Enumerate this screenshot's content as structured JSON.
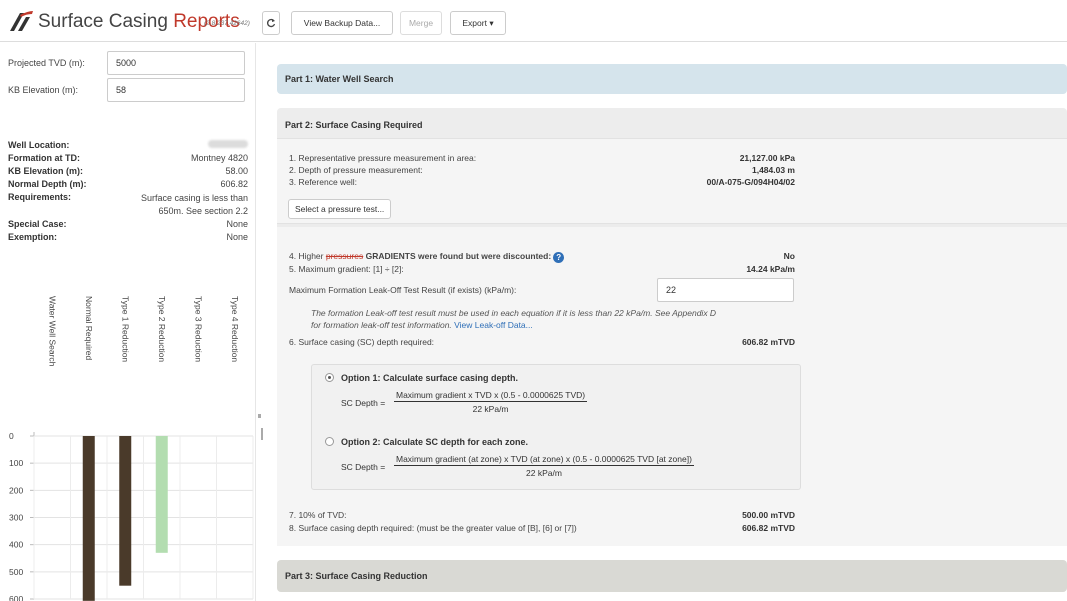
{
  "header": {
    "title_part1": "Surface Casing",
    "title_part2": "Reports",
    "version": "(2.8.237.42642)",
    "buttons": {
      "refresh_icon": "refresh-icon",
      "view_backup": "View Backup Data...",
      "merge": "Merge",
      "export": "Export ▾"
    }
  },
  "inputs": {
    "projected_tvd_label": "Projected TVD (m):",
    "projected_tvd_value": "5000",
    "kb_elevation_label": "KB Elevation (m):",
    "kb_elevation_value": "58"
  },
  "well_info": {
    "location_label": "Well Location:",
    "location_value": "",
    "formation_label": "Formation at TD:",
    "formation_value": "Montney 4820",
    "kb_label": "KB Elevation (m):",
    "kb_value": "58.00",
    "normal_depth_label": "Normal Depth (m):",
    "normal_depth_value": "606.82",
    "requirements_label": "Requirements:",
    "requirements_value": "Surface casing is less than 650m. See section 2.2",
    "special_case_label": "Special Case:",
    "special_case_value": "None",
    "exemption_label": "Exemption:",
    "exemption_value": "None"
  },
  "chart_data": {
    "type": "bar",
    "categories": [
      "Water Well Search",
      "Normal Required",
      "Type 1 Reduction",
      "Type 2 Reduction",
      "Type 3 Reduction",
      "Type 4 Reduction"
    ],
    "values": [
      0,
      606.82,
      551,
      430,
      0,
      0
    ],
    "colors": [
      "#4a3a2a",
      "#4a3a2a",
      "#4a3a2a",
      "#b3ddb0",
      "#4a3a2a",
      "#4a3a2a"
    ],
    "yticks": [
      "0",
      "100",
      "200",
      "300",
      "400",
      "500",
      "600"
    ],
    "ylim": [
      0,
      600
    ],
    "y_inverted": true,
    "grid": true
  },
  "parts": {
    "part1_title": "Part 1: Water Well Search",
    "part2_title": "Part 2: Surface Casing Required",
    "part3_title": "Part 3: Surface Casing Reduction"
  },
  "part2": {
    "r1_label": "1. Representative pressure measurement in area:",
    "r1_value": "21,127.00 kPa",
    "r2_label": "2. Depth of pressure measurement:",
    "r2_value": "1,484.03 m",
    "r3_label": "3. Reference well:",
    "r3_value": "00/A-075-G/094H04/02",
    "select_pressure_button": "Select a pressure test...",
    "r4_prefix": "4. Higher",
    "r4_strike": "pressures",
    "r4_suffix": "GRADIENTS were found but were discounted:",
    "r4_value": "No",
    "r5_label": "5. Maximum gradient: [1] ÷ [2]:",
    "r5_value": "14.24 kPa/m",
    "leakoff_label": "Maximum Formation Leak-Off Test Result (if exists) (kPa/m):",
    "leakoff_value": "22",
    "note_line1": "The formation Leak-off test result must be used in each equation if it is less than 22 kPa/m. See Appendix D",
    "note_line2": "for formation leak-off test information.",
    "note_link": "View Leak-off Data...",
    "r6_label": "6. Surface casing (SC) depth required:",
    "r6_value": "606.82 mTVD",
    "option1_label": "Option 1: Calculate surface casing depth.",
    "option1_lhs": "SC Depth =",
    "option1_num": "Maximum gradient x TVD x (0.5 - 0.0000625 TVD)",
    "option1_den": "22 kPa/m",
    "option2_label": "Option 2: Calculate SC depth for each zone.",
    "option2_lhs": "SC Depth =",
    "option2_num": "Maximum gradient (at zone) x TVD (at zone) x (0.5 - 0.0000625 TVD [at zone])",
    "option2_den": "22 kPa/m",
    "r7_label": "7. 10% of TVD:",
    "r7_value": "500.00 mTVD",
    "r8_label": "8. Surface casing depth required: (must be the greater value of [B], [6] or [7])",
    "r8_value": "606.82 mTVD"
  }
}
